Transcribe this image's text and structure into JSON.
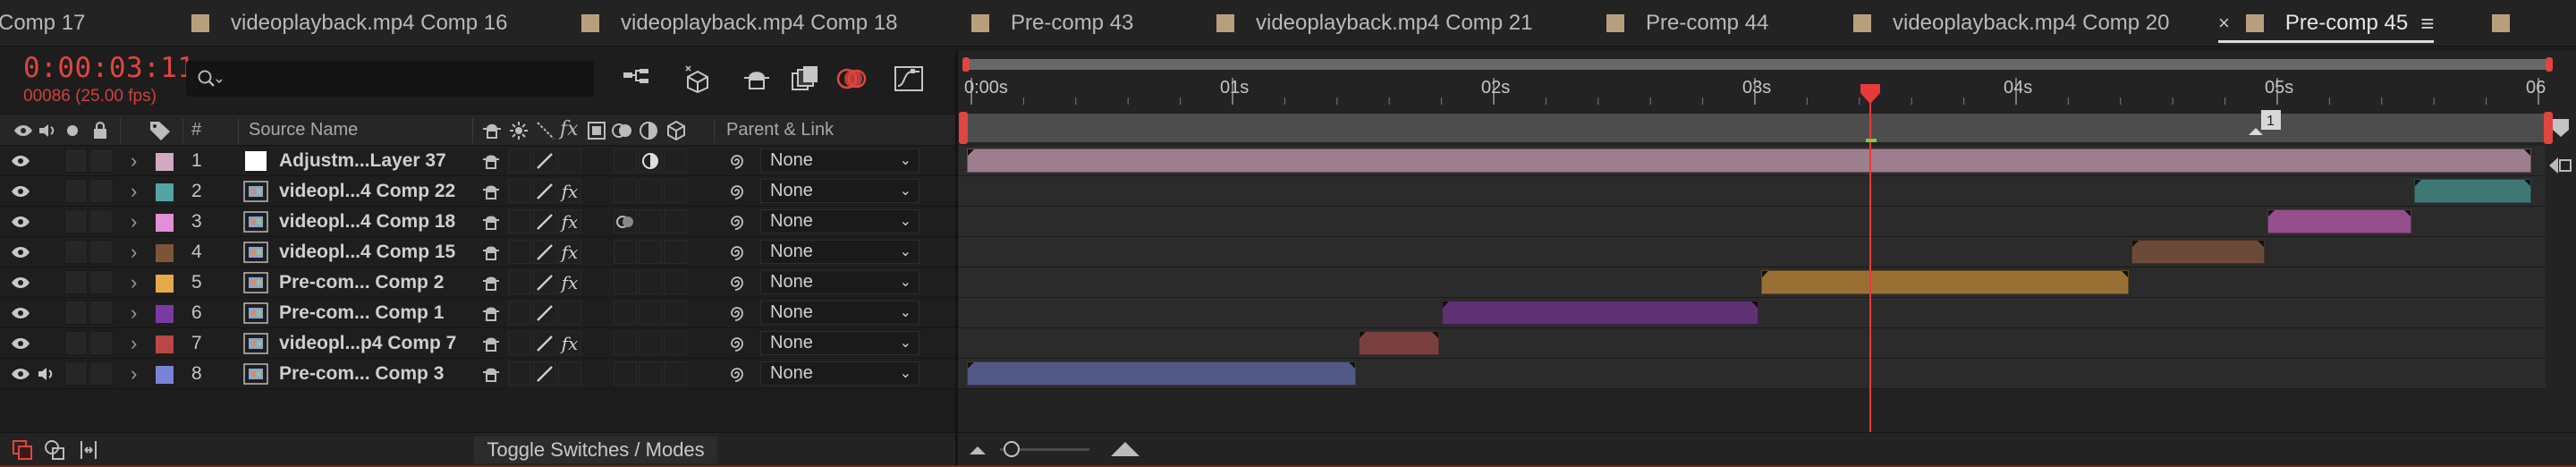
{
  "tabs": [
    {
      "label": "Comp 17",
      "color": "#b89f7c",
      "partial": true
    },
    {
      "label": "videoplayback.mp4 Comp 16",
      "color": "#b89f7c"
    },
    {
      "label": "videoplayback.mp4 Comp 18",
      "color": "#b89f7c"
    },
    {
      "label": "Pre-comp 43",
      "color": "#b89f7c"
    },
    {
      "label": "videoplayback.mp4 Comp 21",
      "color": "#b89f7c"
    },
    {
      "label": "Pre-comp 44",
      "color": "#b89f7c"
    },
    {
      "label": "videoplayback.mp4 Comp 20",
      "color": "#b89f7c"
    },
    {
      "label": "Pre-comp 45",
      "color": "#b89f7c",
      "active": true
    }
  ],
  "header": {
    "timecode": "0:00:03:11",
    "frames": "00086 (25.00 fps)",
    "search_placeholder": ""
  },
  "columns": {
    "number": "#",
    "source_name": "Source Name",
    "parent_link": "Parent & Link"
  },
  "ruler": {
    "labels": [
      "0:00s",
      "01s",
      "02s",
      "03s",
      "04s",
      "05s",
      "06"
    ],
    "marker": "1"
  },
  "layers": [
    {
      "num": "1",
      "name": "Adjustm...Layer 37",
      "label_color": "#d4a8c0",
      "fx": false,
      "parent": "None",
      "bar_color": "#9c7e8e",
      "bar_start": 0.0,
      "bar_end": 6.0,
      "type": "adjustment"
    },
    {
      "num": "2",
      "name": "videopl...4 Comp 22",
      "label_color": "#53a5a5",
      "fx": true,
      "parent": "None",
      "bar_color": "#3f7777",
      "bar_start": 5.54,
      "bar_end": 6.0,
      "type": "comp"
    },
    {
      "num": "3",
      "name": "videopl...4 Comp 18",
      "label_color": "#e08fd8",
      "fx": true,
      "parent": "None",
      "bar_color": "#944f8c",
      "bar_start": 4.98,
      "bar_end": 5.54,
      "type": "comp"
    },
    {
      "num": "4",
      "name": "videopl...4 Comp 15",
      "label_color": "#7e5438",
      "fx": true,
      "parent": "None",
      "bar_color": "#6c4a39",
      "bar_start": 4.46,
      "bar_end": 4.98,
      "type": "comp"
    },
    {
      "num": "5",
      "name": "Pre-com... Comp 2",
      "label_color": "#e5a84b",
      "fx": true,
      "parent": "None",
      "bar_color": "#9a6f34",
      "bar_start": 3.04,
      "bar_end": 4.46,
      "type": "comp"
    },
    {
      "num": "6",
      "name": "Pre-com... Comp 1",
      "label_color": "#7a3aa2",
      "fx": false,
      "parent": "None",
      "bar_color": "#5e3172",
      "bar_start": 1.82,
      "bar_end": 3.04,
      "type": "comp"
    },
    {
      "num": "7",
      "name": "videopl...p4 Comp 7",
      "label_color": "#b84747",
      "fx": true,
      "parent": "None",
      "bar_color": "#7a3f3f",
      "bar_start": 1.5,
      "bar_end": 1.82,
      "type": "comp"
    },
    {
      "num": "8",
      "name": "Pre-com... Comp 3",
      "label_color": "#7a82d8",
      "fx": false,
      "parent": "None",
      "bar_color": "#535987",
      "bar_start": 0.0,
      "bar_end": 1.5,
      "type": "comp",
      "audio": true
    }
  ],
  "playhead_seconds": 3.44,
  "bottom": {
    "toggle_label": "Toggle Switches / Modes"
  },
  "colors": {
    "accent_red": "#e0453f",
    "playhead": "#e83a3a"
  }
}
